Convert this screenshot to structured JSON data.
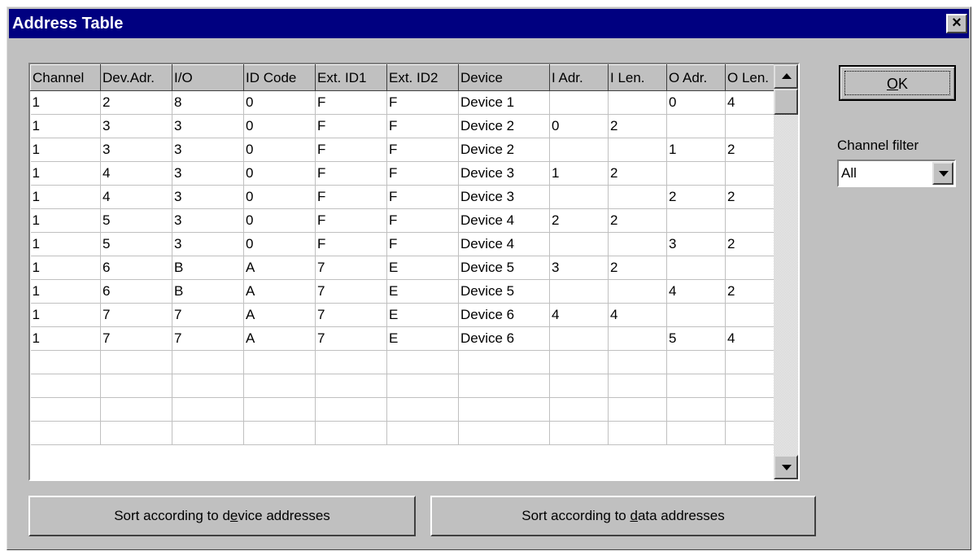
{
  "window": {
    "title": "Address Table",
    "close_glyph": "×"
  },
  "table": {
    "columns": [
      "Channel",
      "Dev.Adr.",
      "I/O",
      "ID Code",
      "Ext. ID1",
      "Ext. ID2",
      "Device",
      "I Adr.",
      "I Len.",
      "O Adr.",
      "O Len."
    ],
    "rows": [
      [
        "1",
        "2",
        "8",
        "0",
        "F",
        "F",
        "Device 1",
        "",
        "",
        "0",
        "4"
      ],
      [
        "1",
        "3",
        "3",
        "0",
        "F",
        "F",
        "Device 2",
        "0",
        "2",
        "",
        ""
      ],
      [
        "1",
        "3",
        "3",
        "0",
        "F",
        "F",
        "Device 2",
        "",
        "",
        "1",
        "2"
      ],
      [
        "1",
        "4",
        "3",
        "0",
        "F",
        "F",
        "Device 3",
        "1",
        "2",
        "",
        ""
      ],
      [
        "1",
        "4",
        "3",
        "0",
        "F",
        "F",
        "Device 3",
        "",
        "",
        "2",
        "2"
      ],
      [
        "1",
        "5",
        "3",
        "0",
        "F",
        "F",
        "Device 4",
        "2",
        "2",
        "",
        ""
      ],
      [
        "1",
        "5",
        "3",
        "0",
        "F",
        "F",
        "Device 4",
        "",
        "",
        "3",
        "2"
      ],
      [
        "1",
        "6",
        "B",
        "A",
        "7",
        "E",
        "Device 5",
        "3",
        "2",
        "",
        ""
      ],
      [
        "1",
        "6",
        "B",
        "A",
        "7",
        "E",
        "Device 5",
        "",
        "",
        "4",
        "2"
      ],
      [
        "1",
        "7",
        "7",
        "A",
        "7",
        "E",
        "Device 6",
        "4",
        "4",
        "",
        ""
      ],
      [
        "1",
        "7",
        "7",
        "A",
        "7",
        "E",
        "Device 6",
        "",
        "",
        "5",
        "4"
      ],
      [
        "",
        "",
        "",
        "",
        "",
        "",
        "",
        "",
        "",
        "",
        ""
      ],
      [
        "",
        "",
        "",
        "",
        "",
        "",
        "",
        "",
        "",
        "",
        ""
      ],
      [
        "",
        "",
        "",
        "",
        "",
        "",
        "",
        "",
        "",
        "",
        ""
      ],
      [
        "",
        "",
        "",
        "",
        "",
        "",
        "",
        "",
        "",
        "",
        ""
      ]
    ]
  },
  "ok_button": {
    "pre": "",
    "mnemonic": "O",
    "post": "K"
  },
  "channel_filter": {
    "label": "Channel filter",
    "value": "All"
  },
  "sort_device_button": {
    "pre": "Sort according to d",
    "mnemonic": "e",
    "post": "vice addresses"
  },
  "sort_data_button": {
    "pre": "Sort according to ",
    "mnemonic": "d",
    "post": "ata addresses"
  },
  "icons": {
    "close": "close-icon",
    "scroll_up": "scroll-up-icon",
    "scroll_down": "scroll-down-icon",
    "dropdown": "chevron-down-icon"
  },
  "colors": {
    "title_bar": "#000080",
    "face": "#c0c0c0"
  }
}
